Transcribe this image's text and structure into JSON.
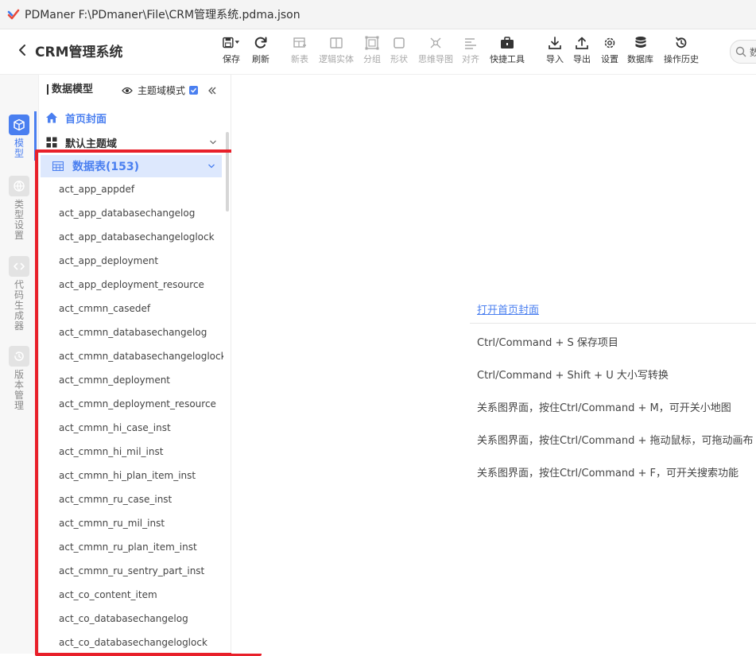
{
  "window": {
    "title": "PDManer  F:\\PDmaner\\File\\CRM管理系统.pdma.json"
  },
  "header": {
    "project_title": "CRM管理系统",
    "tools": [
      {
        "label": "保存"
      },
      {
        "label": "刷新"
      },
      {
        "label": "新表"
      },
      {
        "label": "逻辑实体"
      },
      {
        "label": "分组"
      },
      {
        "label": "形状"
      },
      {
        "label": "思维导图"
      },
      {
        "label": "对齐"
      },
      {
        "label": "快捷工具"
      },
      {
        "label": "导入"
      },
      {
        "label": "导出"
      },
      {
        "label": "设置"
      },
      {
        "label": "数据库"
      },
      {
        "label": "操作历史"
      }
    ],
    "search": {
      "value": "数"
    }
  },
  "rail": {
    "items": [
      {
        "label": "模型"
      },
      {
        "label": "类型设置"
      },
      {
        "label": "代码生成器"
      },
      {
        "label": "版本管理"
      }
    ]
  },
  "panel": {
    "title": "数据模型",
    "domain_mode_label": "主题域模式",
    "home_label": "首页封面",
    "domain_label": "默认主题域",
    "tables_label": "数据表(153)",
    "tables": [
      "act_app_appdef",
      "act_app_databasechangelog",
      "act_app_databasechangeloglock",
      "act_app_deployment",
      "act_app_deployment_resource",
      "act_cmmn_casedef",
      "act_cmmn_databasechangelog",
      "act_cmmn_databasechangeloglock",
      "act_cmmn_deployment",
      "act_cmmn_deployment_resource",
      "act_cmmn_hi_case_inst",
      "act_cmmn_hi_mil_inst",
      "act_cmmn_hi_plan_item_inst",
      "act_cmmn_ru_case_inst",
      "act_cmmn_ru_mil_inst",
      "act_cmmn_ru_plan_item_inst",
      "act_cmmn_ru_sentry_part_inst",
      "act_co_content_item",
      "act_co_databasechangelog",
      "act_co_databasechangeloglock"
    ]
  },
  "main": {
    "open_home_link": "打开首页封面",
    "tips": [
      "Ctrl/Command + S 保存项目",
      "Ctrl/Command + Shift + U 大小写转换",
      "关系图界面，按住Ctrl/Command + M，可开关小地图",
      "关系图界面，按住Ctrl/Command + 拖动鼠标，可拖动画布",
      "关系图界面，按住Ctrl/Command + F，可开关搜索功能"
    ]
  },
  "colors": {
    "accent": "#4a7ff0",
    "highlight": "#e8202a",
    "selected_row": "#dde8fd"
  }
}
